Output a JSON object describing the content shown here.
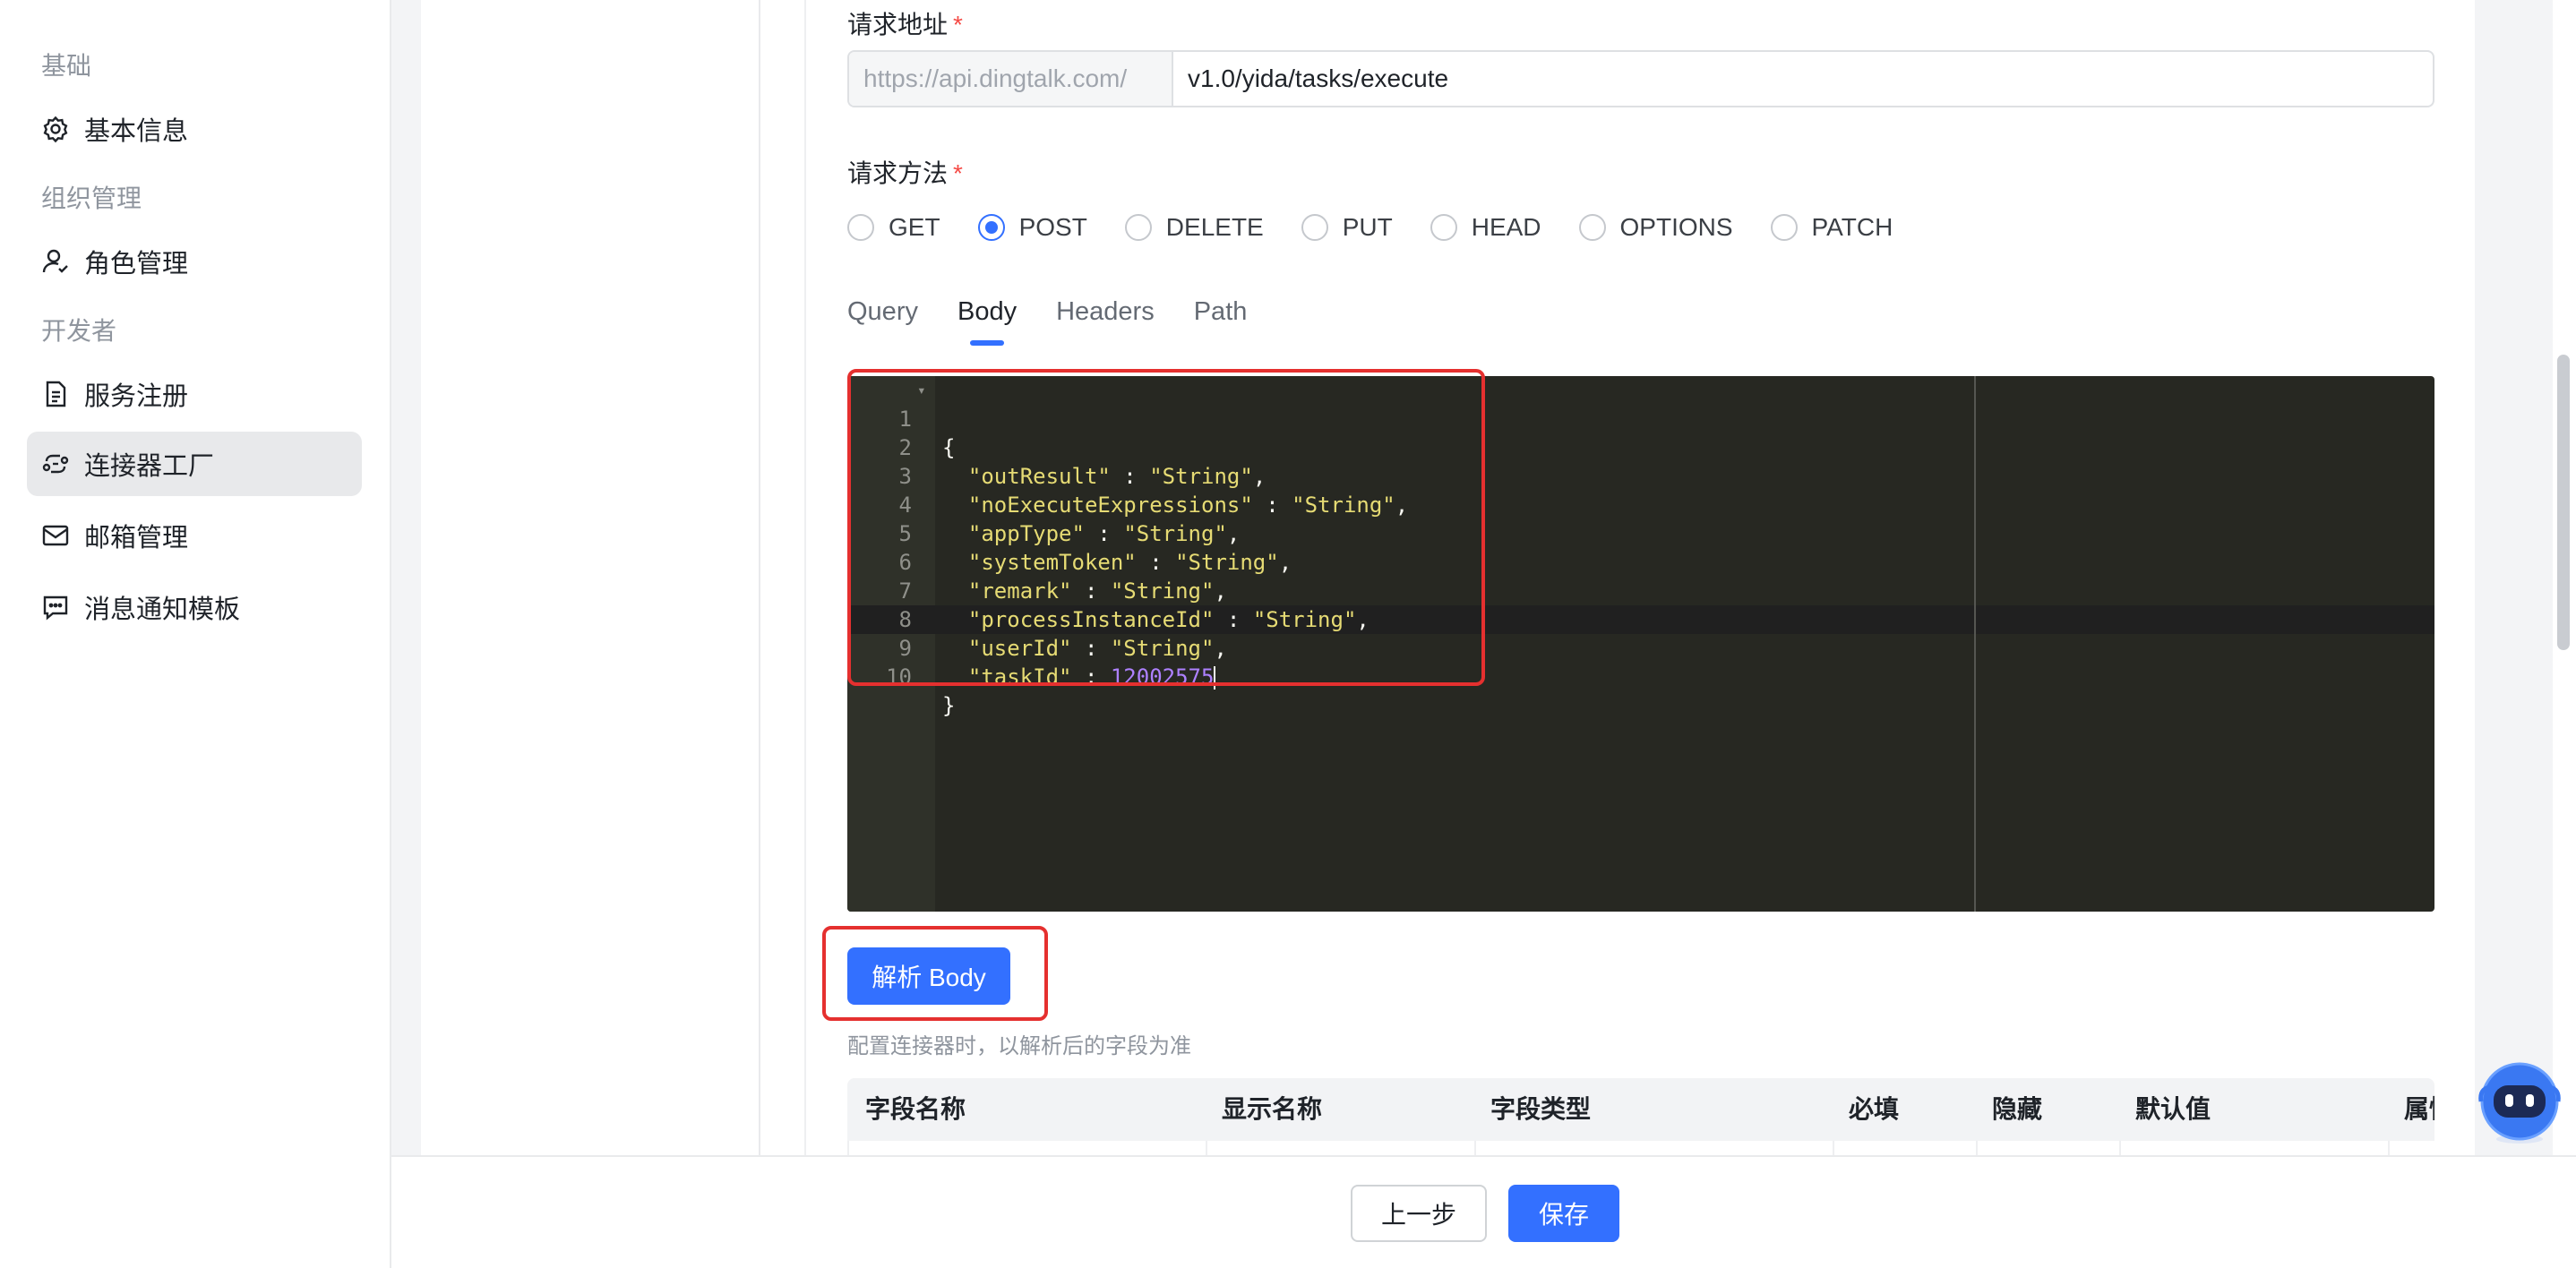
{
  "sidebar": {
    "groups": [
      "基础",
      "组织管理",
      "开发者"
    ],
    "items": [
      {
        "label": "基本信息",
        "icon": "gear-icon"
      },
      {
        "label": "角色管理",
        "icon": "user-role-icon"
      },
      {
        "label": "服务注册",
        "icon": "document-icon"
      },
      {
        "label": "连接器工厂",
        "icon": "connector-icon",
        "active": true
      },
      {
        "label": "邮箱管理",
        "icon": "mail-icon"
      },
      {
        "label": "消息通知模板",
        "icon": "message-icon"
      }
    ]
  },
  "form": {
    "url_label": "请求地址",
    "url_prefix": "https://api.dingtalk.com/",
    "url_value": "v1.0/yida/tasks/execute",
    "method_label": "请求方法",
    "required_mark": "*",
    "methods": [
      "GET",
      "POST",
      "DELETE",
      "PUT",
      "HEAD",
      "OPTIONS",
      "PATCH"
    ],
    "selected_method": "POST",
    "tabs": [
      "Query",
      "Body",
      "Headers",
      "Path"
    ],
    "active_tab": "Body"
  },
  "editor": {
    "line_numbers": [
      "1",
      "2",
      "3",
      "4",
      "5",
      "6",
      "7",
      "8",
      "9",
      "10"
    ],
    "lines": {
      "l1": "{",
      "l2k": "\"outResult\"",
      "l2v": "\"String\"",
      "l3k": "\"noExecuteExpressions\"",
      "l3v": "\"String\"",
      "l4k": "\"appType\"",
      "l4v": "\"String\"",
      "l5k": "\"systemToken\"",
      "l5v": "\"String\"",
      "l6k": "\"remark\"",
      "l6v": "\"String\"",
      "l7k": "\"processInstanceId\"",
      "l7v": "\"String\"",
      "l8k": "\"userId\"",
      "l8v": "\"String\"",
      "l9k": "\"taskId\"",
      "l9v": "12002575",
      "l10": "}"
    },
    "colors": {
      "background": "#272822",
      "key": "#e6db74",
      "string": "#e6db74",
      "number": "#ae81ff",
      "highlight": "#e5302f"
    }
  },
  "parse_button": "解析 Body",
  "hint": "配置连接器时，以解析后的字段为准",
  "table": {
    "headers": [
      "字段名称",
      "显示名称",
      "字段类型",
      "必填",
      "隐藏",
      "默认值",
      "属性"
    ]
  },
  "footer": {
    "prev_label": "上一步",
    "save_label": "保存"
  },
  "accent_color": "#3370ff"
}
